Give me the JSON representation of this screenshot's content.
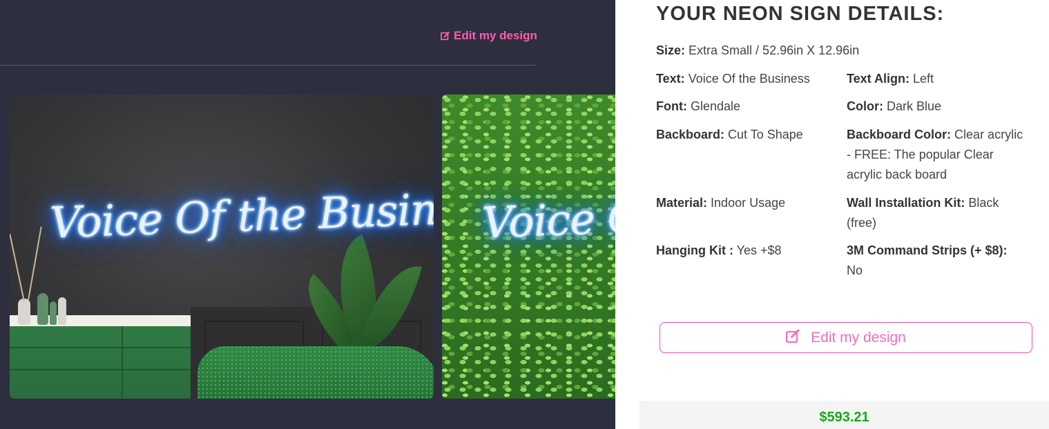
{
  "top_edit_link": {
    "label": "Edit my design"
  },
  "gallery": {
    "slides": [
      {
        "neon_text": "Voice Of the Business",
        "scene": "dark-wall-living-room"
      },
      {
        "neon_text": "Voice Of the Business",
        "scene": "green-hedge"
      }
    ],
    "neon_color": "#1f7bff"
  },
  "details": {
    "title": "YOUR NEON SIGN DETAILS:",
    "size": {
      "label": "Size:",
      "value": "Extra Small / 52.96in X 12.96in"
    },
    "text": {
      "label": "Text:",
      "value": "Voice Of the Business"
    },
    "text_align": {
      "label": "Text Align:",
      "value": "Left"
    },
    "font": {
      "label": "Font:",
      "value": "Glendale"
    },
    "color": {
      "label": "Color:",
      "value": "Dark Blue"
    },
    "backboard": {
      "label": "Backboard:",
      "value": "Cut To Shape"
    },
    "backboard_color": {
      "label": "Backboard Color:",
      "value_line1": "Clear acrylic",
      "value_line2": "- FREE: The popular Clear",
      "value_line3": "acrylic back board"
    },
    "material": {
      "label": "Material:",
      "value": "Indoor Usage"
    },
    "wall_kit": {
      "label": "Wall Installation Kit:",
      "value_line1": "Black",
      "value_line2": "(free)"
    },
    "hanging_kit": {
      "label": "Hanging Kit :",
      "value": "Yes +$8"
    },
    "command_strips": {
      "label": "3M Command Strips (+ $8):",
      "value": "No"
    },
    "edit_button": {
      "label": "Edit my design"
    },
    "price": "$593.21"
  },
  "colors": {
    "accent_pink": "#ff5cb0",
    "price_green": "#1ea51e",
    "dark_bg": "#2d2f3e"
  },
  "icons": [
    "pen-square-icon"
  ]
}
